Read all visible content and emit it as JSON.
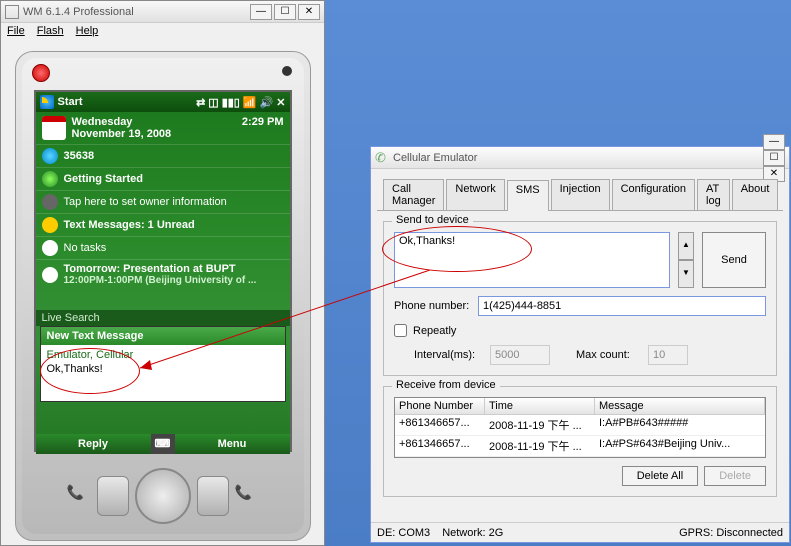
{
  "wm": {
    "title": "WM 6.1.4 Professional",
    "menu": {
      "file": "File",
      "flash": "Flash",
      "help": "Help"
    }
  },
  "today": {
    "start": "Start",
    "day": "Wednesday",
    "date": "November 19, 2008",
    "time": "2:29 PM",
    "signal": "35638",
    "getting_started": "Getting Started",
    "owner": "Tap here to set owner information",
    "messages": "Text Messages: 1 Unread",
    "tasks": "No tasks",
    "tomorrow_title": "Tomorrow: Presentation at BUPT",
    "tomorrow_sub": "12:00PM-1:00PM (Beijing University of ...",
    "live_search": "Live Search"
  },
  "sms_popup": {
    "header": "New Text Message",
    "from": "Emulator, Cellular",
    "body": "Ok,Thanks!"
  },
  "softkeys": {
    "left": "Reply",
    "right": "Menu"
  },
  "emu": {
    "title": "Cellular Emulator",
    "tabs": [
      "Call Manager",
      "Network",
      "SMS",
      "Injection",
      "Configuration",
      "AT log",
      "About"
    ],
    "active_tab": 2,
    "send_legend": "Send to device",
    "message": "Ok,Thanks!",
    "send_btn": "Send",
    "phone_label": "Phone number:",
    "phone_value": "1(425)444-8851",
    "repeatly": "Repeatly",
    "interval_label": "Interval(ms):",
    "interval_value": "5000",
    "maxcount_label": "Max count:",
    "maxcount_value": "10",
    "recv_legend": "Receive from device",
    "recv_cols": {
      "phone": "Phone Number",
      "time": "Time",
      "msg": "Message"
    },
    "recv_rows": [
      {
        "phone": "+861346657...",
        "time": "2008-11-19 下午 ...",
        "msg": "I:A#PB#643#####"
      },
      {
        "phone": "+861346657...",
        "time": "2008-11-19 下午 ...",
        "msg": "I:A#PS#643#Beijing Univ..."
      }
    ],
    "delete_all": "Delete All",
    "delete": "Delete",
    "status": {
      "de": "DE: COM3",
      "net": "Network: 2G",
      "gprs": "GPRS: Disconnected"
    }
  }
}
